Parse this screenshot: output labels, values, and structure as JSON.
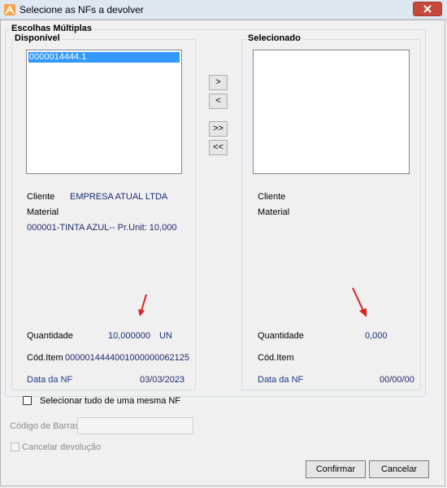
{
  "window": {
    "title": "Selecione as NFs a devolver",
    "close_label": "×"
  },
  "group": {
    "title": "Escolhas Múltiplas"
  },
  "left_panel": {
    "title": "Disponível",
    "items": [
      "0000014444.1"
    ],
    "cliente_label": "Cliente",
    "cliente_value": "EMPRESA ATUAL LTDA",
    "material_label": "Material",
    "material_value": "000001-TINTA AZUL-- Pr.Unit: 10,000",
    "quantidade_label": "Quantidade",
    "quantidade_value": "10,000000",
    "quantidade_unit": "UN",
    "cod_item_label": "Cód.Item",
    "cod_item_value": "0000014444001000000062125",
    "data_nf_label": "Data da NF",
    "data_nf_value": "03/03/2023"
  },
  "right_panel": {
    "title": "Selecionado",
    "cliente_label": "Cliente",
    "material_label": "Material",
    "quantidade_label": "Quantidade",
    "quantidade_value": "0,000",
    "cod_item_label": "Cód.Item",
    "data_nf_label": "Data da NF",
    "data_nf_value": "00/00/00"
  },
  "transfer_buttons": {
    "move_right": ">",
    "move_left": "<",
    "move_all_right": ">>",
    "move_all_left": "<<"
  },
  "select_all_nf": {
    "label": "Selecionar tudo de uma mesma NF",
    "checked": false
  },
  "barcode": {
    "label": "Código de Barras",
    "value": ""
  },
  "cancel_return": {
    "label": "Cancelar devolução",
    "checked": false
  },
  "buttons": {
    "confirm": "Confirmar",
    "cancel": "Cancelar"
  },
  "colors": {
    "selection": "#3399ff",
    "value_text": "#1f2a6e",
    "annotation_arrow": "#e02020",
    "close_button": "#c7493c"
  },
  "annotations": {
    "arrows": 2
  }
}
